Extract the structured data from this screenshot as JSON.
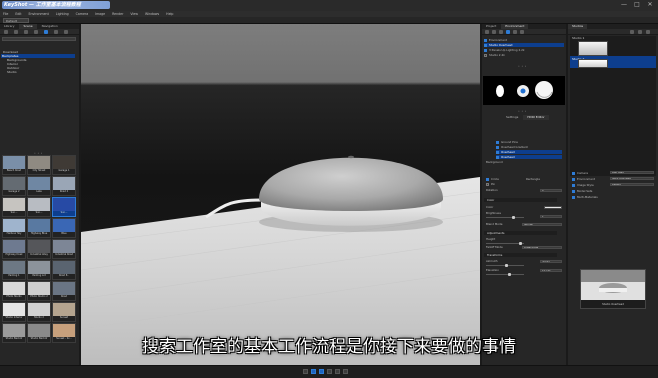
{
  "titlebar": {
    "logo_text": "KeyShot — 工作室基本流程教程",
    "minimize": "—",
    "maximize": "□",
    "close": "✕"
  },
  "menu": [
    "File",
    "Edit",
    "Environment",
    "Lighting",
    "Camera",
    "Image",
    "Render",
    "View",
    "Windows",
    "Help"
  ],
  "toolbar": {
    "workspace": "Default Workspace"
  },
  "left_panel": {
    "tabs": [
      "Library",
      "Scene",
      "Navigation"
    ],
    "tree": [
      {
        "label": "Download",
        "selected": false
      },
      {
        "label": "Backplates",
        "selected": true
      },
      {
        "label": "Backgrounds",
        "selected": false
      },
      {
        "label": "Interior",
        "selected": false
      },
      {
        "label": "Outdoor",
        "selected": false
      },
      {
        "label": "Studio",
        "selected": false
      }
    ],
    "thumbnails": [
      {
        "caption": "Beach Road",
        "color": "#7a8fa8",
        "selected": false
      },
      {
        "caption": "City Street",
        "color": "#8f8a82",
        "selected": false
      },
      {
        "caption": "Garage 1",
        "color": "#3f3a35",
        "selected": false
      },
      {
        "caption": "Garage 2",
        "color": "#646b72",
        "selected": false
      },
      {
        "caption": "Lake",
        "color": "#6f87a3",
        "selected": false
      },
      {
        "caption": "Road 2",
        "color": "#9aa6b6",
        "selected": false
      },
      {
        "caption": "Sun...",
        "color": "#c6c4c0",
        "selected": false
      },
      {
        "caption": "Sun...",
        "color": "#b8bcc2",
        "selected": false
      },
      {
        "caption": "Sun...",
        "color": "#274aa5",
        "selected": true
      },
      {
        "caption": "Harbour Sky",
        "color": "#9fb4cd",
        "selected": false
      },
      {
        "caption": "Highway Blue",
        "color": "#5979a1",
        "selected": false
      },
      {
        "caption": "Blue",
        "color": "#3a67b5",
        "selected": false
      },
      {
        "caption": "Highway Dusk",
        "color": "#6e7a90",
        "selected": false
      },
      {
        "caption": "Industrial Alley",
        "color": "#55565a",
        "selected": false
      },
      {
        "caption": "Industrial Road",
        "color": "#7d8696",
        "selected": false
      },
      {
        "caption": "Parking 1",
        "color": "#6d7884",
        "selected": false
      },
      {
        "caption": "Parking Lot",
        "color": "#8c939b",
        "selected": false
      },
      {
        "caption": "Road P...",
        "color": "#5a6470",
        "selected": false
      },
      {
        "caption": "Photo Studio",
        "color": "#d8d8d8",
        "selected": false
      },
      {
        "caption": "Photo Studio 2",
        "color": "#cfcfcf",
        "selected": false
      },
      {
        "caption": "Road",
        "color": "#6a7584",
        "selected": false
      },
      {
        "caption": "Studio Interior",
        "color": "#e6e6e6",
        "selected": false
      },
      {
        "caption": "Studio 2",
        "color": "#d2d2d2",
        "selected": false
      },
      {
        "caption": "Sunset",
        "color": "#b4a48f",
        "selected": false
      },
      {
        "caption": "Studio Backdr",
        "color": "#9b9b9b",
        "selected": false
      },
      {
        "caption": "Studio Backdr",
        "color": "#8a8a8a",
        "selected": false
      },
      {
        "caption": "Sunset - Sc...",
        "color": "#c7a07c",
        "selected": false
      }
    ]
  },
  "viewport": {
    "bg_top": "#7a7a7a",
    "bg_dark": "#2f2f2f",
    "table_color": "#d8d8d8",
    "product": "smart speaker"
  },
  "subtitle": "搜索工作室的基本工作流程是你接下来要做的事情",
  "right_panel": {
    "tabs": [
      "Project",
      "Environment"
    ],
    "env_list": [
      {
        "label": "Environment",
        "checked": true,
        "selected": false
      },
      {
        "label": "Studio Overhead",
        "checked": true,
        "selected": true
      },
      {
        "label": "3 Panels Up Lighting 2.2k",
        "checked": true,
        "selected": false
      },
      {
        "label": "Studio 2.2k",
        "checked": false,
        "selected": false
      }
    ],
    "sub_tabs": [
      "Settings",
      "HDRI Editor"
    ],
    "hdri_list": [
      {
        "label": "Ground Pins",
        "selected": false
      },
      {
        "label": "Overhead Gradient",
        "selected": false
      },
      {
        "label": "Overhead",
        "selected": true
      },
      {
        "label": "Overhead",
        "selected": true
      },
      {
        "label": "Background",
        "selected": false
      }
    ],
    "options": {
      "circle_label": "Circle",
      "rect_label": "Rectangle",
      "pin_label": "Pin",
      "rotation_label": "Rotation",
      "rotation_value": "0°",
      "color_section": "Color",
      "color_label": "Color",
      "brightness_label": "Brightness",
      "brightness_value": "1",
      "blend_label": "Blend Mode",
      "blend_value": "Normal",
      "adjust_section": "Adjustments",
      "height_label": "Height",
      "falloff_label": "Falloff Mode",
      "falloff_value": "Power/Edge",
      "transform_section": "Transforms",
      "azimuth_label": "Azimuth",
      "azimuth_value": "-0.125°",
      "elevation_label": "Elevation",
      "elevation_value": "11.795°"
    }
  },
  "studios_panel": {
    "title": "Studios",
    "items": [
      {
        "label": "Studio 1",
        "selected": false
      },
      {
        "label": "Studio 2",
        "selected": true
      }
    ],
    "settings": [
      {
        "label": "Camera",
        "value": "Last Used"
      },
      {
        "label": "Environment",
        "value": "Night Overhead"
      },
      {
        "label": "Image Style",
        "value": "Default"
      },
      {
        "label": "Model Sets",
        "value": ""
      },
      {
        "label": "Multi-Materials",
        "value": ""
      }
    ],
    "preview_caption": "Studio Overhead"
  }
}
